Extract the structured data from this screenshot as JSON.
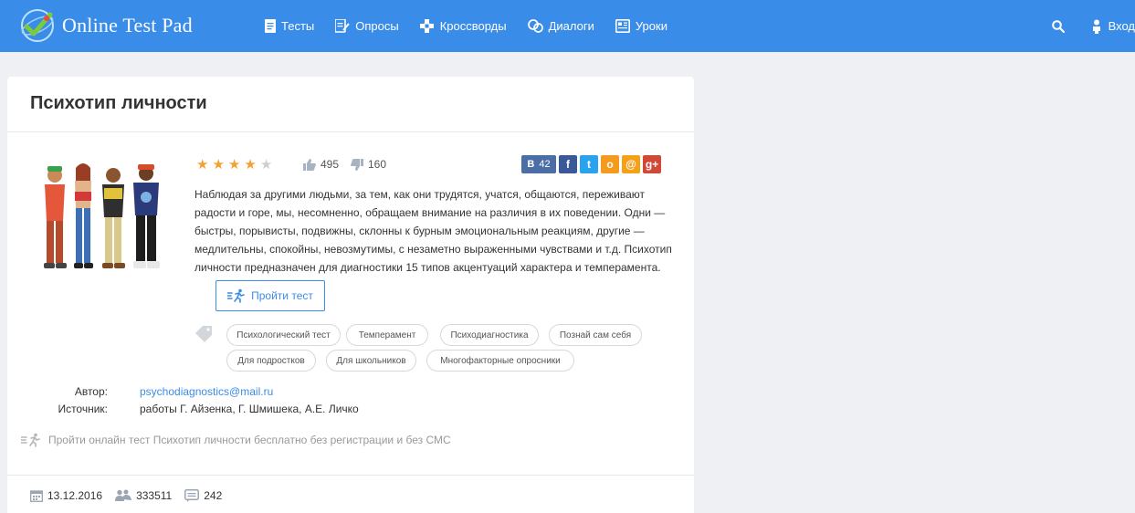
{
  "header": {
    "logo_text": "Online Test Pad",
    "nav": [
      {
        "label": "Тесты",
        "icon": "document-icon"
      },
      {
        "label": "Опросы",
        "icon": "survey-icon"
      },
      {
        "label": "Кроссворды",
        "icon": "crossword-icon"
      },
      {
        "label": "Диалоги",
        "icon": "dialog-icon"
      },
      {
        "label": "Уроки",
        "icon": "lessons-icon"
      }
    ],
    "login_label": "Вход"
  },
  "test": {
    "title": "Психотип личности",
    "rating": 4,
    "rating_max": 5,
    "likes": "495",
    "dislikes": "160",
    "share": {
      "vk_label": "В",
      "vk_count": "42",
      "fb_label": "f",
      "tw_label": "t",
      "ok_label": "о",
      "ml_label": "@",
      "gp_label": "g+"
    },
    "description": "Наблюдая за другими людьми, за тем, как они трудятся, учатся, общаются, переживают радости и горе, мы, несомненно, обращаем внимание на различия в их поведении. Одни — быстры, порывисты, подвижны, склонны к бурным эмоциональным реакциям, другие — медлительны, спокойны, невозмутимы, с незаметно выраженными чувствами и т.д. Психотип личности предназначен для диагностики 15 типов акцентуаций характера и темперамента.",
    "take_button": "Пройти тест",
    "tags": [
      "Психологический тест",
      "Темперамент",
      "Психодиагностика",
      "Познай сам себя",
      "Для подростков",
      "Для школьников",
      "Многофакторные опросники"
    ],
    "author_label": "Автор:",
    "author_value": "psychodiagnostics@mail.ru",
    "source_label": "Источник:",
    "source_value": "работы Г. Айзенка, Г. Шмишека, А.Е. Личко",
    "promo_text": "Пройти онлайн тест Психотип личности бесплатно без регистрации и без СМС",
    "date": "13.12.2016",
    "participants": "333511",
    "comments": "242"
  },
  "colors": {
    "brand": "#3a8ce9",
    "star": "#f5a030",
    "page_bg": "#eef0f3"
  }
}
